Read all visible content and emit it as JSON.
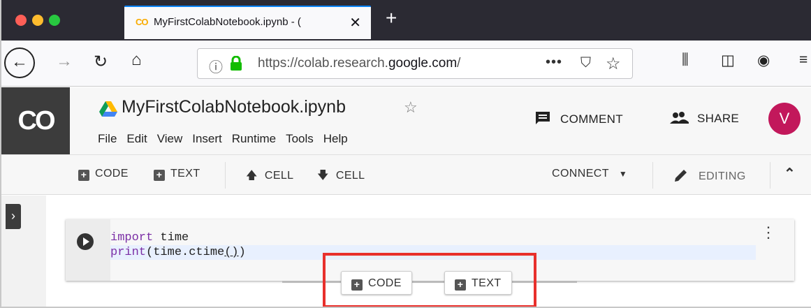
{
  "browser": {
    "tab_title": "MyFirstColabNotebook.ipynb - (",
    "tab_favicon": "CO",
    "tab_close": "✕",
    "new_tab": "+",
    "url_prefix": "https://colab.research.",
    "url_domain": "google.com",
    "url_suffix": "/",
    "more_label": "•••",
    "icons": [
      "back-icon",
      "forward-icon",
      "reload-icon",
      "home-icon",
      "info-icon",
      "lock-icon",
      "pocket-icon",
      "bookmark-star-icon",
      "library-icon",
      "sidebar-icon",
      "account-icon",
      "menu-icon"
    ]
  },
  "colab": {
    "logo": "CO",
    "notebook_title": "MyFirstColabNotebook.ipynb",
    "menu": [
      "File",
      "Edit",
      "View",
      "Insert",
      "Runtime",
      "Tools",
      "Help"
    ],
    "comment_label": "COMMENT",
    "share_label": "SHARE",
    "avatar_letter": "V",
    "avatar_color": "#c2185b"
  },
  "toolbar": {
    "add_code": "CODE",
    "add_text": "TEXT",
    "cell_up": "CELL",
    "cell_down": "CELL",
    "connect": "CONNECT",
    "editing": "EDITING"
  },
  "cell": {
    "line1_kw": "import",
    "line1_rest": " time",
    "line2_fn": "print",
    "line2_rest_a": "(time.ctime",
    "line2_parens": "()",
    "line2_rest_b": ")"
  },
  "insert_bar": {
    "code_label": "CODE",
    "text_label": "TEXT"
  },
  "colors": {
    "highlight": "#e8302c",
    "keyword": "#7b2fa6"
  }
}
